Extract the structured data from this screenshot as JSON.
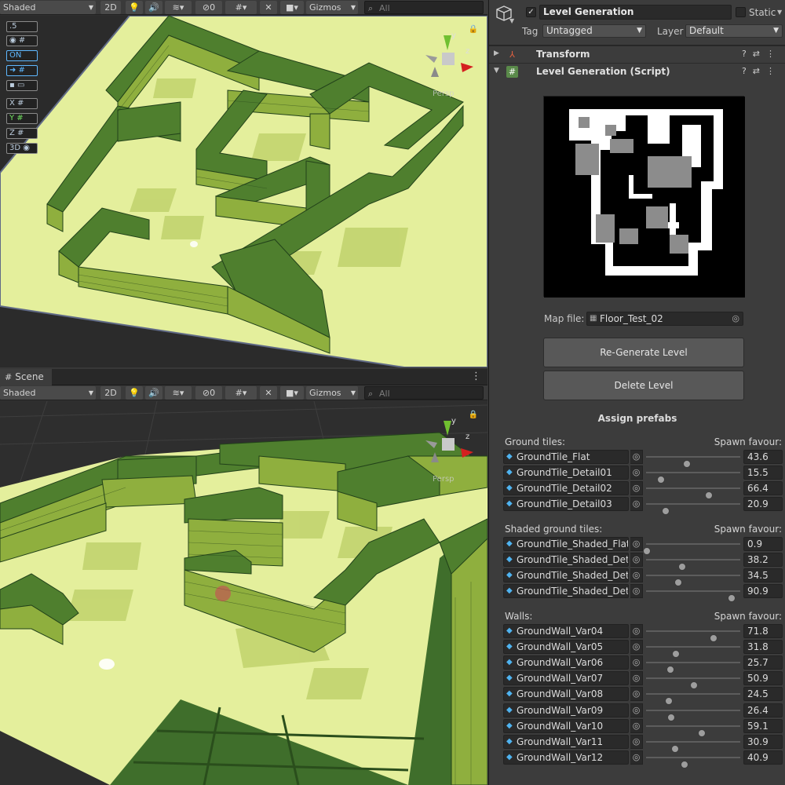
{
  "scene_top": {
    "shading_mode": "Shaded",
    "toggle_2d": "2D",
    "hidden_count": "0",
    "gizmos_label": "Gizmos",
    "search_placeholder": "All",
    "gizmo_axis_y": "y",
    "gizmo_axis_z": "z",
    "projection_label": "Persp",
    "overlays": {
      "snap_value": ".5",
      "toggle_on": "ON",
      "axis_x": "X",
      "axis_y": "Y",
      "axis_z": "Z",
      "mode_3d": "3D"
    }
  },
  "scene_bottom": {
    "tab_label": "Scene",
    "shading_mode": "Shaded",
    "toggle_2d": "2D",
    "hidden_count": "0",
    "gizmos_label": "Gizmos",
    "search_placeholder": "All",
    "gizmo_axis_y": "y",
    "gizmo_axis_z": "z",
    "projection_label": "Persp"
  },
  "inspector": {
    "object_name": "Level Generation",
    "object_active": true,
    "static_label": "Static",
    "tag_label": "Tag",
    "tag_value": "Untagged",
    "layer_label": "Layer",
    "layer_value": "Default",
    "components": {
      "transform": "Transform",
      "script": "Level Generation (Script)"
    },
    "map_file_label": "Map file:",
    "map_file_value": "Floor_Test_02",
    "regenerate_button": "Re-Generate Level",
    "delete_button": "Delete Level",
    "assign_title": "Assign prefabs",
    "spawn_favour_label": "Spawn favour:",
    "groups": [
      {
        "label": "Ground tiles:",
        "items": [
          {
            "name": "GroundTile_Flat",
            "value": "43.6"
          },
          {
            "name": "GroundTile_Detail01",
            "value": "15.5"
          },
          {
            "name": "GroundTile_Detail02",
            "value": "66.4"
          },
          {
            "name": "GroundTile_Detail03",
            "value": "20.9"
          }
        ]
      },
      {
        "label": "Shaded ground tiles:",
        "items": [
          {
            "name": "GroundTile_Shaded_Flat",
            "value": "0.9"
          },
          {
            "name": "GroundTile_Shaded_Detai",
            "value": "38.2"
          },
          {
            "name": "GroundTile_Shaded_Detai",
            "value": "34.5"
          },
          {
            "name": "GroundTile_Shaded_Detai",
            "value": "90.9"
          }
        ]
      },
      {
        "label": "Walls:",
        "items": [
          {
            "name": "GroundWall_Var04",
            "value": "71.8"
          },
          {
            "name": "GroundWall_Var05",
            "value": "31.8"
          },
          {
            "name": "GroundWall_Var06",
            "value": "25.7"
          },
          {
            "name": "GroundWall_Var07",
            "value": "50.9"
          },
          {
            "name": "GroundWall_Var08",
            "value": "24.5"
          },
          {
            "name": "GroundWall_Var09",
            "value": "26.4"
          },
          {
            "name": "GroundWall_Var10",
            "value": "59.1"
          },
          {
            "name": "GroundWall_Var11",
            "value": "30.9"
          },
          {
            "name": "GroundWall_Var12",
            "value": "40.9"
          }
        ]
      }
    ]
  },
  "colors": {
    "ground_light": "#e4ef9c",
    "ground_detail": "#bdd068",
    "wall_top": "#4f7f2e",
    "wall_dark": "#2f5a20",
    "wall_face": "#8faf3e",
    "outer_dark": "#3f6e2b",
    "inspector_bg": "#3c3c3c",
    "accent_blue": "#4fb3f0"
  }
}
